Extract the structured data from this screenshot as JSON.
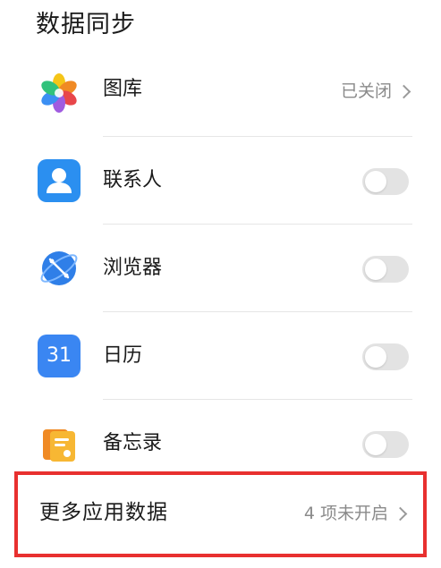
{
  "section": {
    "title": "数据同步"
  },
  "rows": [
    {
      "label": "图库",
      "status": "已关闭",
      "control": "chevron",
      "icon": "gallery-icon"
    },
    {
      "label": "联系人",
      "control": "toggle",
      "enabled": false,
      "icon": "contacts-icon"
    },
    {
      "label": "浏览器",
      "control": "toggle",
      "enabled": false,
      "icon": "browser-icon"
    },
    {
      "label": "日历",
      "control": "toggle",
      "enabled": false,
      "icon": "calendar-icon",
      "icon_text": "31"
    },
    {
      "label": "备忘录",
      "control": "toggle",
      "enabled": false,
      "icon": "notes-icon"
    }
  ],
  "more": {
    "label": "更多应用数据",
    "status": "4 项未开启"
  },
  "colors": {
    "highlight_border": "#e8302f",
    "toggle_off": "#e3e3e3",
    "secondary_text": "#8a8a8a",
    "contacts_blue": "#2b8ff0",
    "calendar_blue": "#3a86f2",
    "browser_blue": "#2f7fe8",
    "notes_orange": "#f5a623"
  }
}
